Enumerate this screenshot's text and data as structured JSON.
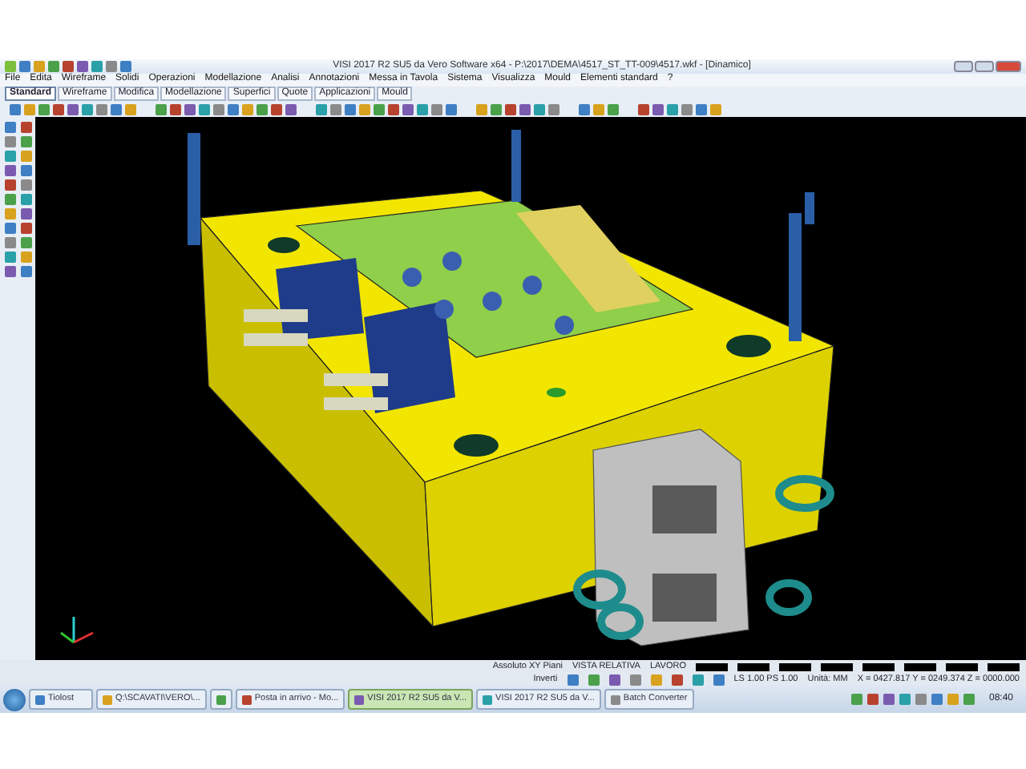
{
  "window": {
    "title": "VISI 2017 R2 SU5 da Vero Software x64 - P:\\2017\\DEMA\\4517_ST_TT-009\\4517.wkf - [Dinamico]"
  },
  "menu": [
    "File",
    "Edita",
    "Wireframe",
    "Solidi",
    "Operazioni",
    "Modellazione",
    "Analisi",
    "Annotazioni",
    "Messa in Tavola",
    "Sistema",
    "Visualizza",
    "Mould",
    "Elementi standard",
    "?"
  ],
  "toolbar_tabs": [
    {
      "label": "Standard",
      "selected": true
    },
    {
      "label": "Wireframe",
      "selected": false
    },
    {
      "label": "Modifica",
      "selected": false
    },
    {
      "label": "Modellazione",
      "selected": false
    },
    {
      "label": "Superfici",
      "selected": false
    },
    {
      "label": "Quote",
      "selected": false
    },
    {
      "label": "Applicazioni",
      "selected": false
    },
    {
      "label": "Mould",
      "selected": false
    }
  ],
  "status_bar": {
    "row_1": [
      "Assoluto XY Piani",
      "VISTA RELATIVA",
      "LAVORO"
    ],
    "invert_button": "Inverti",
    "scale": "LS 1.00 PS 1.00",
    "units": "Unità: MM",
    "coordinates": "X = 0427.817 Y = 0249.374 Z = 0000.000"
  },
  "taskbar": {
    "items": [
      {
        "label": "Tiolost",
        "selected": false
      },
      {
        "label": "Q:\\SCAVATI\\VERO\\...",
        "selected": false
      },
      {
        "selected": false
      },
      {
        "label": "Posta in arrivo - Mo...",
        "selected": false
      },
      {
        "label": "VISI 2017 R2 SU5 da V...",
        "selected": true
      },
      {
        "label": "VISI 2017 R2 SU5 da V...",
        "selected": false
      },
      {
        "label": "Batch Converter",
        "selected": false
      }
    ],
    "clock": "08:40"
  }
}
